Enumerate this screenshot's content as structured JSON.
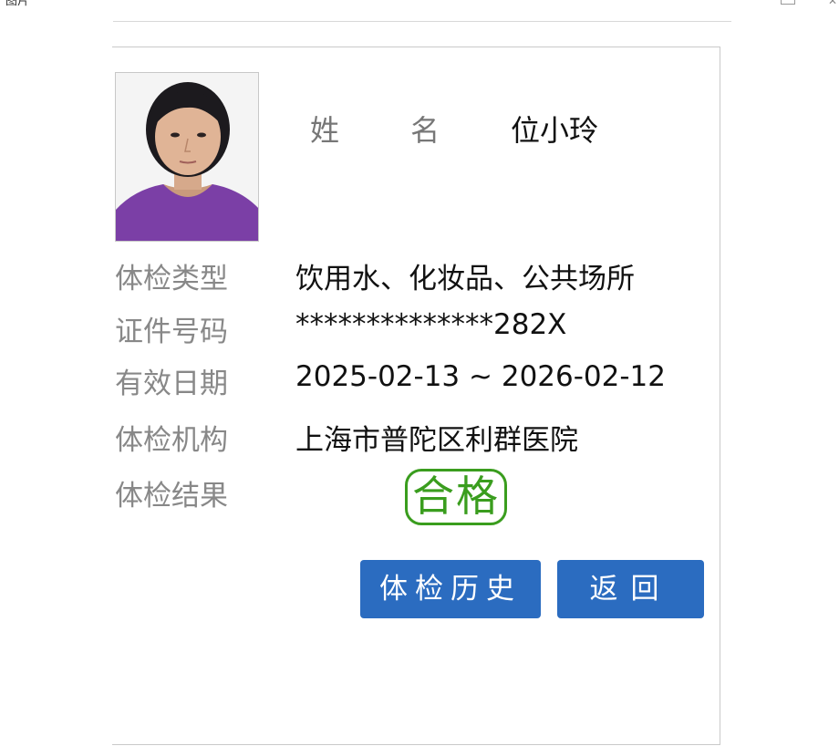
{
  "window": {
    "title": "图片"
  },
  "person": {
    "name_label": "姓 名",
    "name": "位小玲"
  },
  "fields": [
    {
      "label": "体检类型",
      "value": "饮用水、化妆品、公共场所"
    },
    {
      "label": "证件号码",
      "value": "**************282X"
    },
    {
      "label": "有效日期",
      "value": "2025-02-13 ~ 2026-02-12"
    },
    {
      "label": "体检机构",
      "value": "上海市普陀区利群医院"
    },
    {
      "label": "体检结果",
      "value": ""
    }
  ],
  "result": {
    "stamp_text": "合格",
    "color": "#3a9d1e"
  },
  "buttons": {
    "history_label": "体检历史",
    "back_label": "返回",
    "color": "#2b6cc0"
  }
}
